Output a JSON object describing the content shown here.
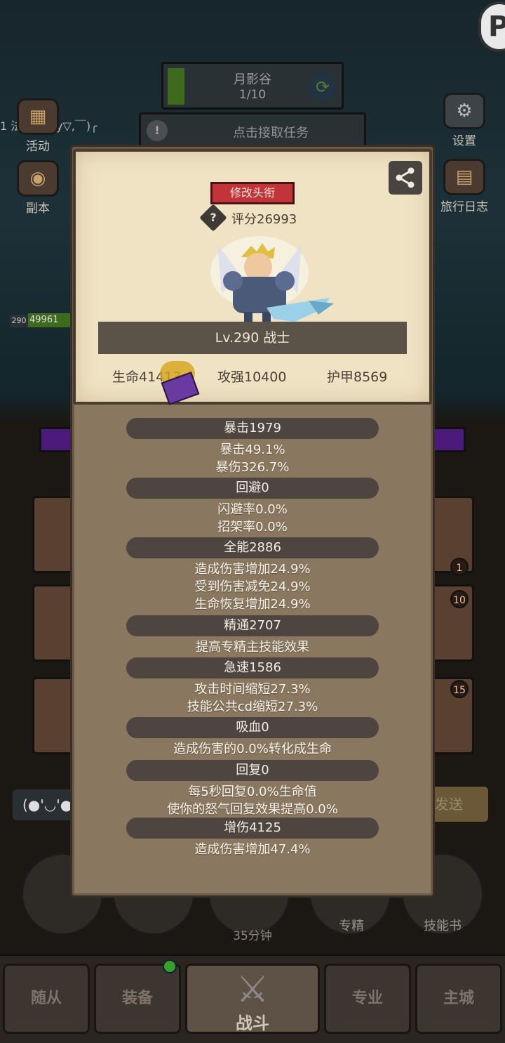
{
  "background": {
    "map": {
      "name": "月影谷",
      "progress": "1/10"
    },
    "task": {
      "label": "点击接取任务"
    },
    "chat_line": "1 法师: (￣y▽,￣)╭",
    "left_icons": [
      {
        "label": "活动",
        "icon": "event-icon"
      },
      {
        "label": "副本",
        "icon": "dungeon-icon"
      }
    ],
    "right_icons": [
      {
        "label": "设置",
        "icon": "gear-icon"
      },
      {
        "label": "旅行日志",
        "icon": "journal-icon"
      }
    ],
    "player_level": "290",
    "player_hp": "49961",
    "slot_badges": [
      "1",
      "10",
      "15"
    ],
    "chat_input": "(●'◡'●",
    "send_label": "发送",
    "round_buttons": [
      {
        "label": "专精"
      },
      {
        "label": "技能书"
      }
    ],
    "timer": "35分钟",
    "nav_tabs": [
      {
        "label": "随从"
      },
      {
        "label": "装备"
      },
      {
        "label": "战斗",
        "active": true
      },
      {
        "label": "专业"
      },
      {
        "label": "主城"
      }
    ]
  },
  "card": {
    "title_button": "修改头衔",
    "score": "评分26993",
    "level_class": "Lv.290 战士",
    "stats": {
      "hp": "生命41413",
      "attack": "攻强10400",
      "armor": "护甲8569"
    }
  },
  "stat_groups": [
    {
      "head": "暴击1979",
      "lines": [
        "暴击49.1%",
        "暴伤326.7%"
      ]
    },
    {
      "head": "回避0",
      "lines": [
        "闪避率0.0%",
        "招架率0.0%"
      ]
    },
    {
      "head": "全能2886",
      "lines": [
        "造成伤害增加24.9%",
        "受到伤害减免24.9%",
        "生命恢复增加24.9%"
      ]
    },
    {
      "head": "精通2707",
      "lines": [
        "提高专精主技能效果"
      ]
    },
    {
      "head": "急速1586",
      "lines": [
        "攻击时间缩短27.3%",
        "技能公共cd缩短27.3%"
      ]
    },
    {
      "head": "吸血0",
      "lines": [
        "造成伤害的0.0%转化成生命"
      ]
    },
    {
      "head": "回复0",
      "lines": [
        "每5秒回复0.0%生命值",
        "使你的怒气回复效果提高0.0%"
      ]
    },
    {
      "head": "增伤4125",
      "lines": [
        "造成伤害增加47.4%"
      ]
    }
  ],
  "colors": {
    "card_bg": "#efe3c4",
    "panel_bg": "#8a7760",
    "title_button": "#c0343a",
    "stat_head_bg": "#4e4540"
  }
}
